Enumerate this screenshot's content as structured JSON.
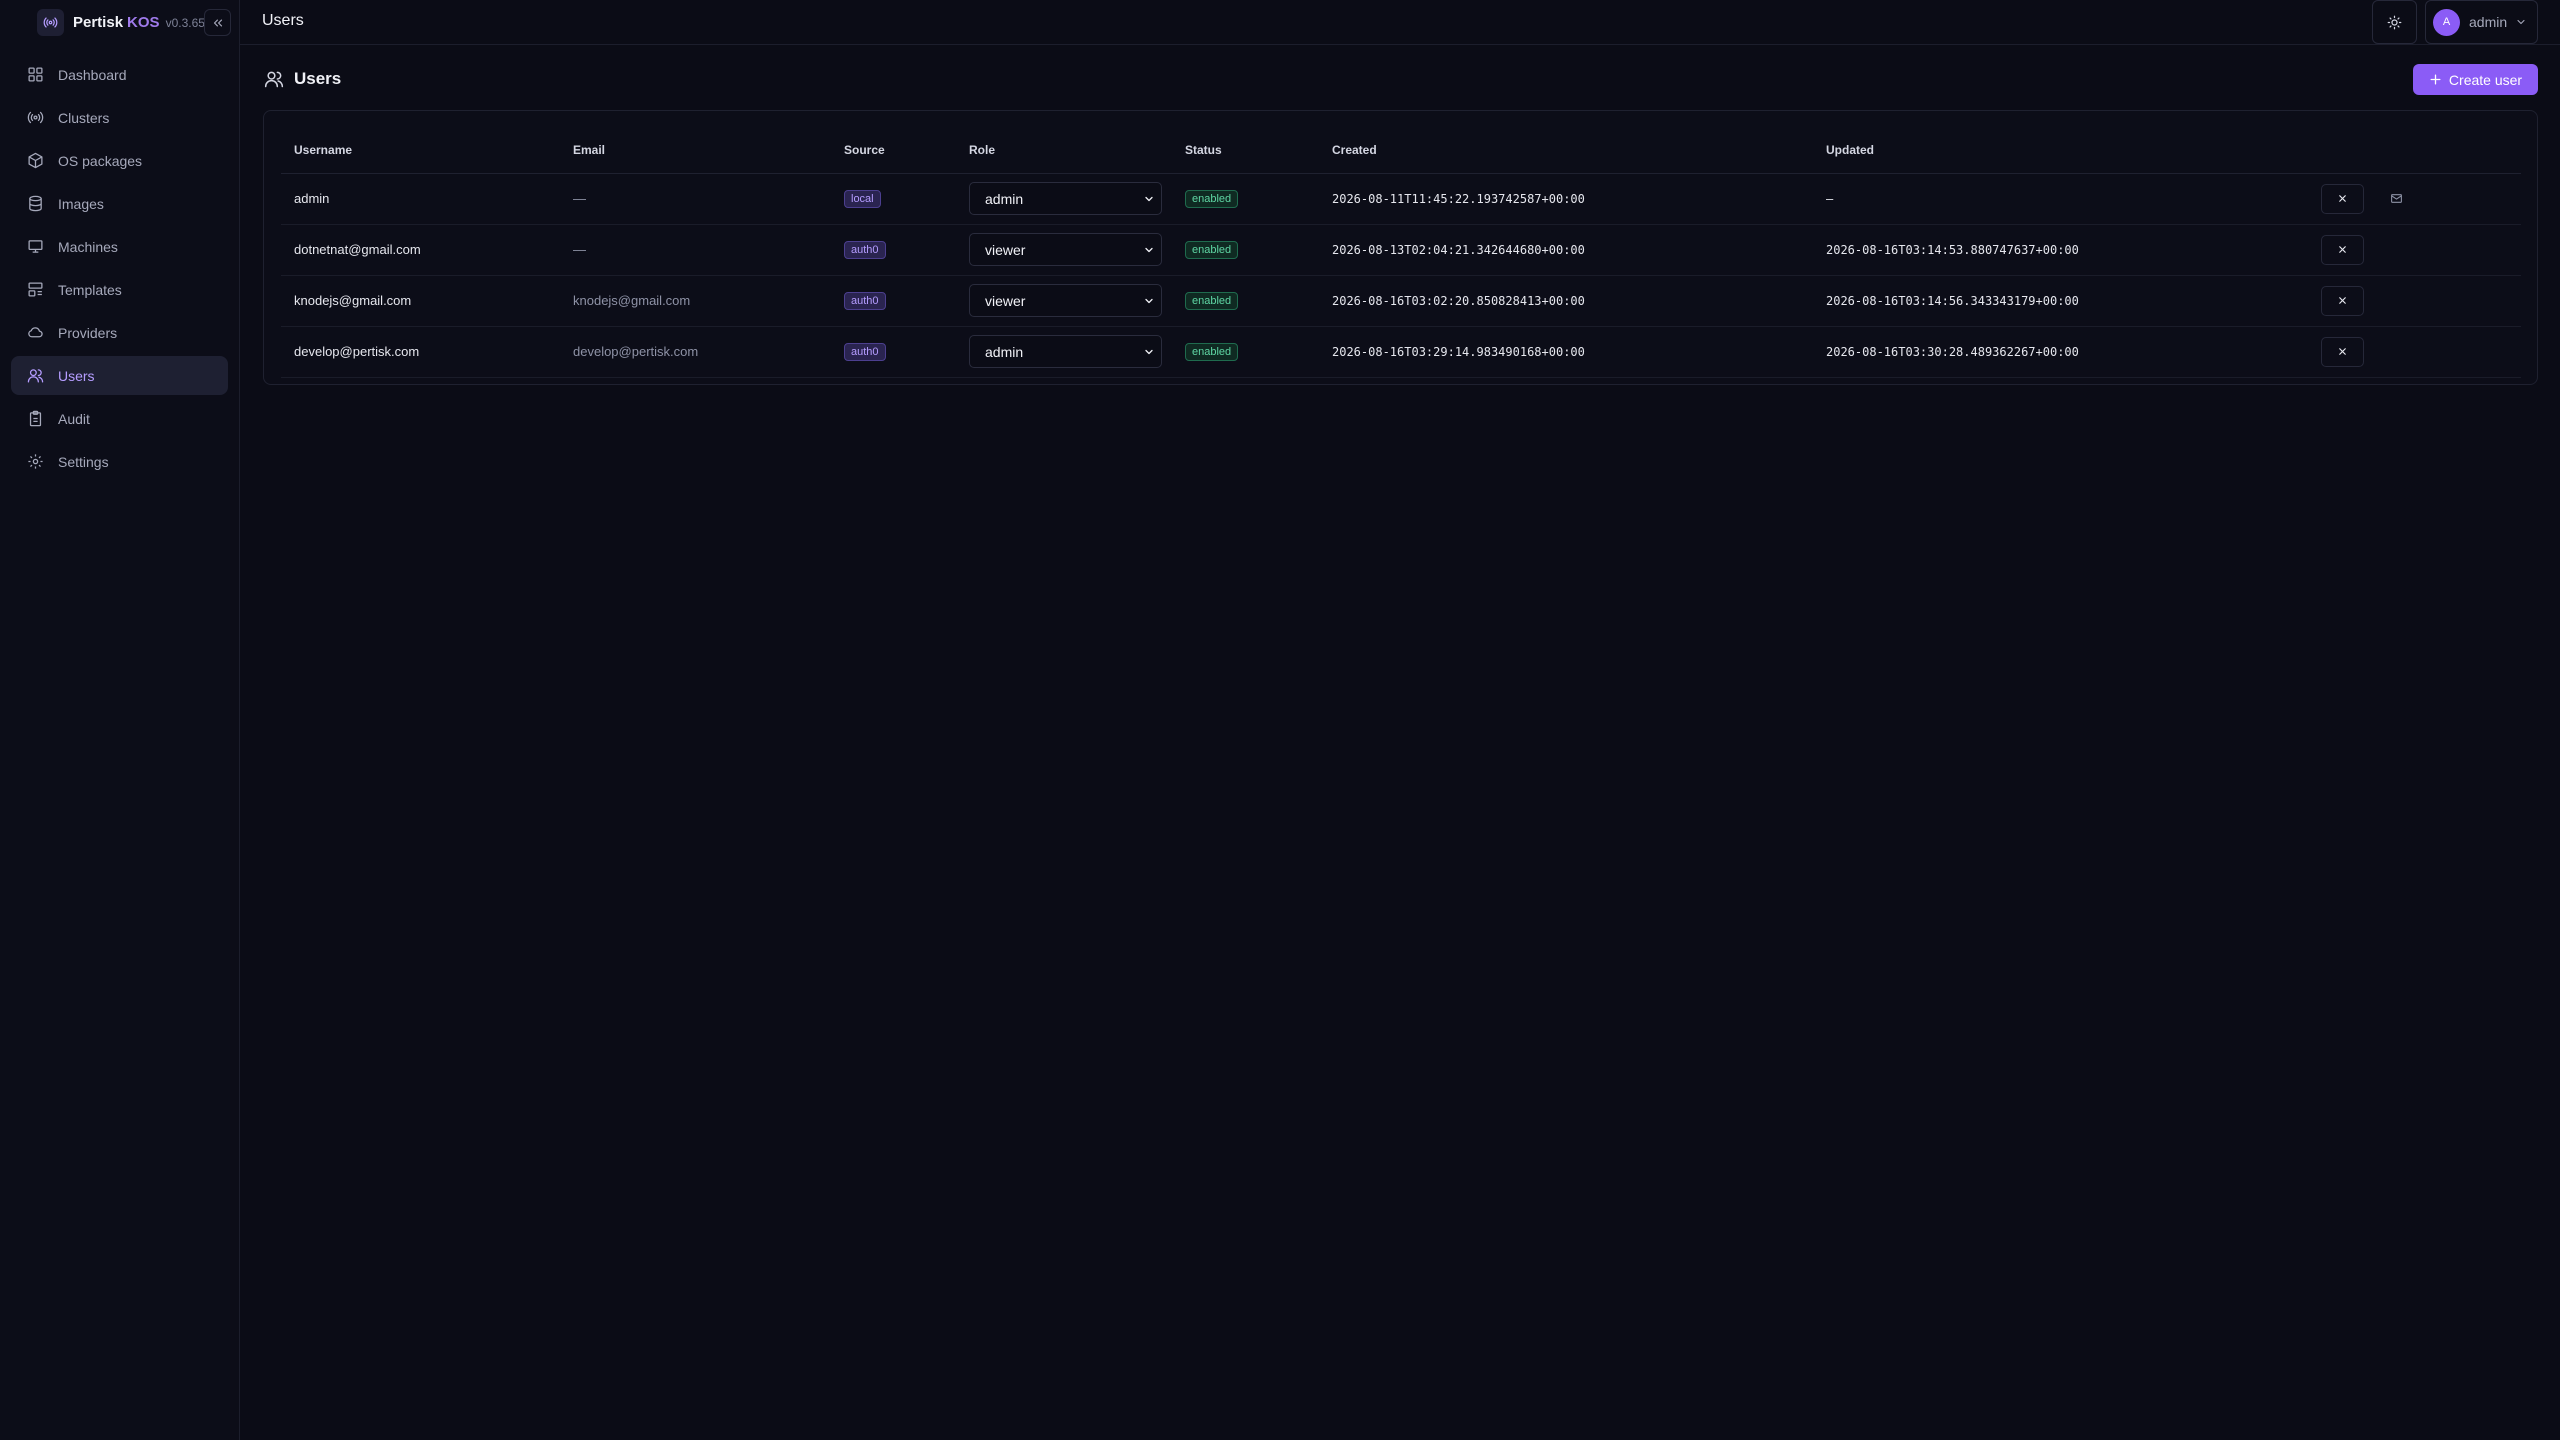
{
  "app": {
    "brand_name": "Pertisk",
    "brand_product": "KOS",
    "version": "v0.3.65"
  },
  "sidebar": {
    "items": [
      {
        "label": "Dashboard",
        "icon": "dashboard-icon"
      },
      {
        "label": "Clusters",
        "icon": "broadcast-icon"
      },
      {
        "label": "OS packages",
        "icon": "package-icon"
      },
      {
        "label": "Images",
        "icon": "database-icon"
      },
      {
        "label": "Machines",
        "icon": "monitor-icon"
      },
      {
        "label": "Templates",
        "icon": "template-icon"
      },
      {
        "label": "Providers",
        "icon": "cloud-icon"
      },
      {
        "label": "Users",
        "icon": "users-icon",
        "active": true
      },
      {
        "label": "Audit",
        "icon": "clipboard-icon"
      },
      {
        "label": "Settings",
        "icon": "gear-icon"
      }
    ]
  },
  "header": {
    "title": "Users",
    "user_initial": "A",
    "user_name": "admin"
  },
  "page": {
    "title": "Users",
    "create_button": "Create user"
  },
  "table": {
    "columns": [
      "Username",
      "Email",
      "Source",
      "Role",
      "Status",
      "Created",
      "Updated"
    ],
    "rows": [
      {
        "username": "admin",
        "email": "—",
        "source": "local",
        "role": "admin",
        "status": "enabled",
        "created": "2026-08-11T11:45:22.193742587+00:00",
        "updated": "–",
        "has_mail_action": true
      },
      {
        "username": "dotnetnat@gmail.com",
        "email": "—",
        "source": "auth0",
        "role": "viewer",
        "status": "enabled",
        "created": "2026-08-13T02:04:21.342644680+00:00",
        "updated": "2026-08-16T03:14:53.880747637+00:00",
        "has_mail_action": false
      },
      {
        "username": "knodejs@gmail.com",
        "email": "knodejs@gmail.com",
        "source": "auth0",
        "role": "viewer",
        "status": "enabled",
        "created": "2026-08-16T03:02:20.850828413+00:00",
        "updated": "2026-08-16T03:14:56.343343179+00:00",
        "has_mail_action": false
      },
      {
        "username": "develop@pertisk.com",
        "email": "develop@pertisk.com",
        "source": "auth0",
        "role": "admin",
        "status": "enabled",
        "created": "2026-08-16T03:29:14.983490168+00:00",
        "updated": "2026-08-16T03:30:28.489362267+00:00",
        "has_mail_action": false
      }
    ]
  },
  "colors": {
    "accent": "#8b5cf6",
    "background": "#0b0c16",
    "status_enabled": "#5fd6a4"
  }
}
